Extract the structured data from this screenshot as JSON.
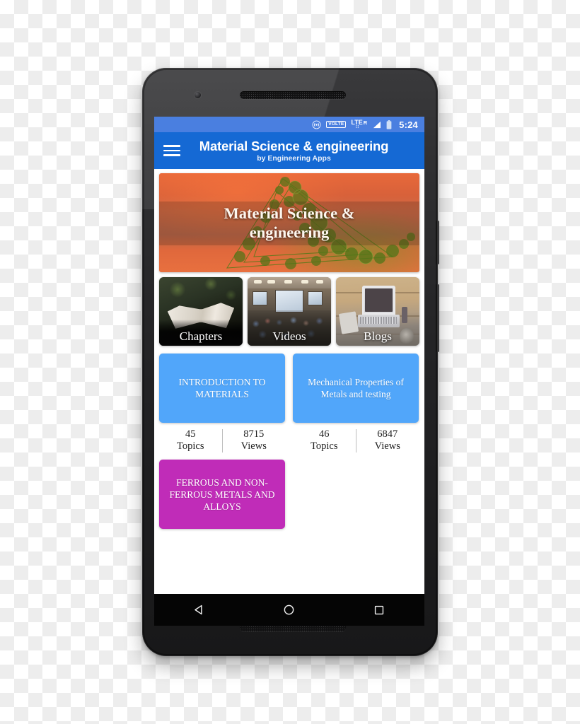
{
  "device": {
    "name": "android-smartphone",
    "nav_bar": {
      "back_label": "Back",
      "home_label": "Home",
      "recents_label": "Recent apps"
    }
  },
  "status_bar": {
    "time": "5:24",
    "icons": [
      "hotspot-icon",
      "volte-icon",
      "lte-icon",
      "roaming-icon",
      "signal-icon",
      "battery-icon"
    ],
    "volte_label": "VOLTE",
    "lte_label": "LTE",
    "roaming_label": "R",
    "background_color": "#4a7fe0"
  },
  "app_bar": {
    "menu_icon": "hamburger-menu-icon",
    "title": "Material Science & engineering",
    "subtitle": "by Engineering Apps",
    "background_color": "#1569d4"
  },
  "hero": {
    "title": "Material Science &\nengineering",
    "title_line1": "Material Science &",
    "title_line2": "engineering"
  },
  "categories": [
    {
      "label": "Chapters",
      "name": "category-card-chapters"
    },
    {
      "label": "Videos",
      "name": "category-card-videos"
    },
    {
      "label": "Blogs",
      "name": "category-card-blogs"
    }
  ],
  "topics": [
    {
      "title": "INTRODUCTION TO MATERIALS",
      "color": "#51a6fa",
      "topics_count": "45",
      "topics_label": "Topics",
      "views_count": "8715",
      "views_label": "Views"
    },
    {
      "title": "Mechanical Properties of Metals and testing",
      "color": "#51a6fa",
      "topics_count": "46",
      "topics_label": "Topics",
      "views_count": "6847",
      "views_label": "Views"
    },
    {
      "title": "FERROUS AND NON-FERROUS METALS AND ALLOYS",
      "color": "#c02cb8"
    }
  ]
}
